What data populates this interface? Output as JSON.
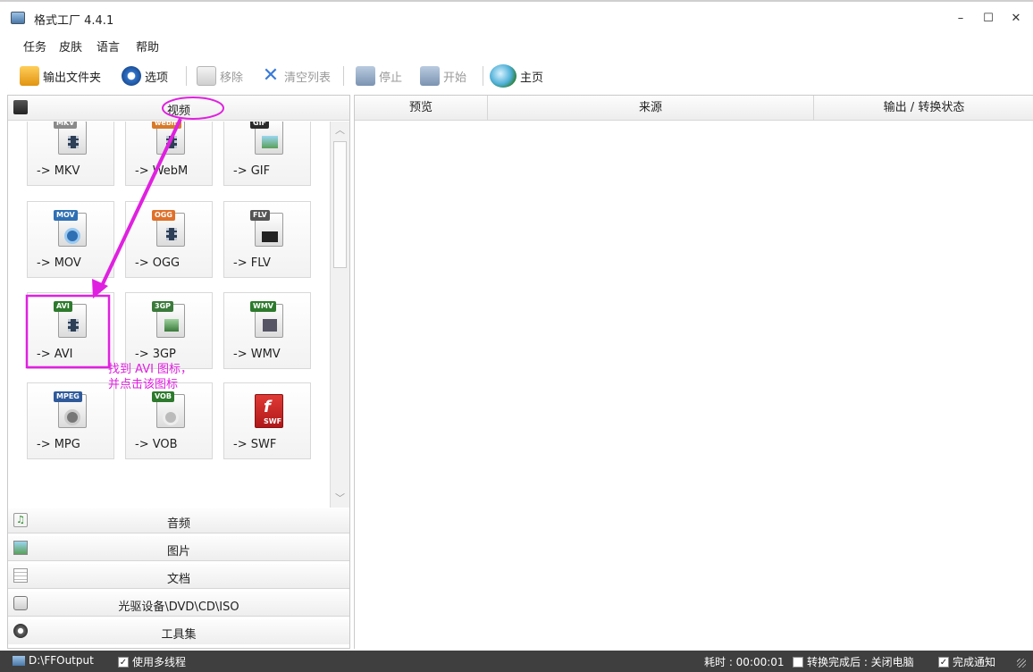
{
  "window": {
    "title": "格式工厂 4.4.1",
    "minimize": "–",
    "maximize": "☐",
    "close": "✕"
  },
  "menu": [
    "任务",
    "皮肤",
    "语言",
    "帮助"
  ],
  "toolbar": {
    "output_folder": "输出文件夹",
    "options": "选项",
    "remove": "移除",
    "clear_list": "清空列表",
    "stop": "停止",
    "start": "开始",
    "home": "主页"
  },
  "categories": {
    "video": "视频",
    "audio": "音频",
    "image": "图片",
    "document": "文档",
    "rom": "光驱设备\\DVD\\CD\\ISO",
    "tools": "工具集"
  },
  "tiles": [
    {
      "label": "-> MKV",
      "tag": "MKV",
      "color": "#8a8a8a"
    },
    {
      "label": "-> WebM",
      "tag": "webm",
      "color": "#d77a2a"
    },
    {
      "label": "-> GIF",
      "tag": "GIF",
      "color": "#2a2a2a"
    },
    {
      "label": "-> MOV",
      "tag": "MOV",
      "color": "#2f6fb4"
    },
    {
      "label": "-> OGG",
      "tag": "OGG",
      "color": "#e0702a"
    },
    {
      "label": "-> FLV",
      "tag": "FLV",
      "color": "#555555"
    },
    {
      "label": "-> AVI",
      "tag": "AVI",
      "color": "#2d7a2d"
    },
    {
      "label": "-> 3GP",
      "tag": "3GP",
      "color": "#3a7a3a"
    },
    {
      "label": "-> WMV",
      "tag": "WMV",
      "color": "#2d7a2d"
    },
    {
      "label": "-> MPG",
      "tag": "MPEG",
      "color": "#2f5a9a"
    },
    {
      "label": "-> VOB",
      "tag": "VOB",
      "color": "#2d7a2d"
    },
    {
      "label": "-> SWF",
      "tag": "SWF",
      "color": "#c8201e"
    }
  ],
  "columns": [
    "预览",
    "来源",
    "输出 / 转换状态"
  ],
  "annotation": {
    "line1": "找到 AVI 图标，",
    "line2": "并点击该图标",
    "color": "#e020e0"
  },
  "status": {
    "output_path": "D:\\FFOutput",
    "multithread": "使用多线程",
    "elapsed": "耗时 : 00:00:01",
    "after_convert": "转换完成后 : 关闭电脑",
    "notify": "完成通知"
  }
}
